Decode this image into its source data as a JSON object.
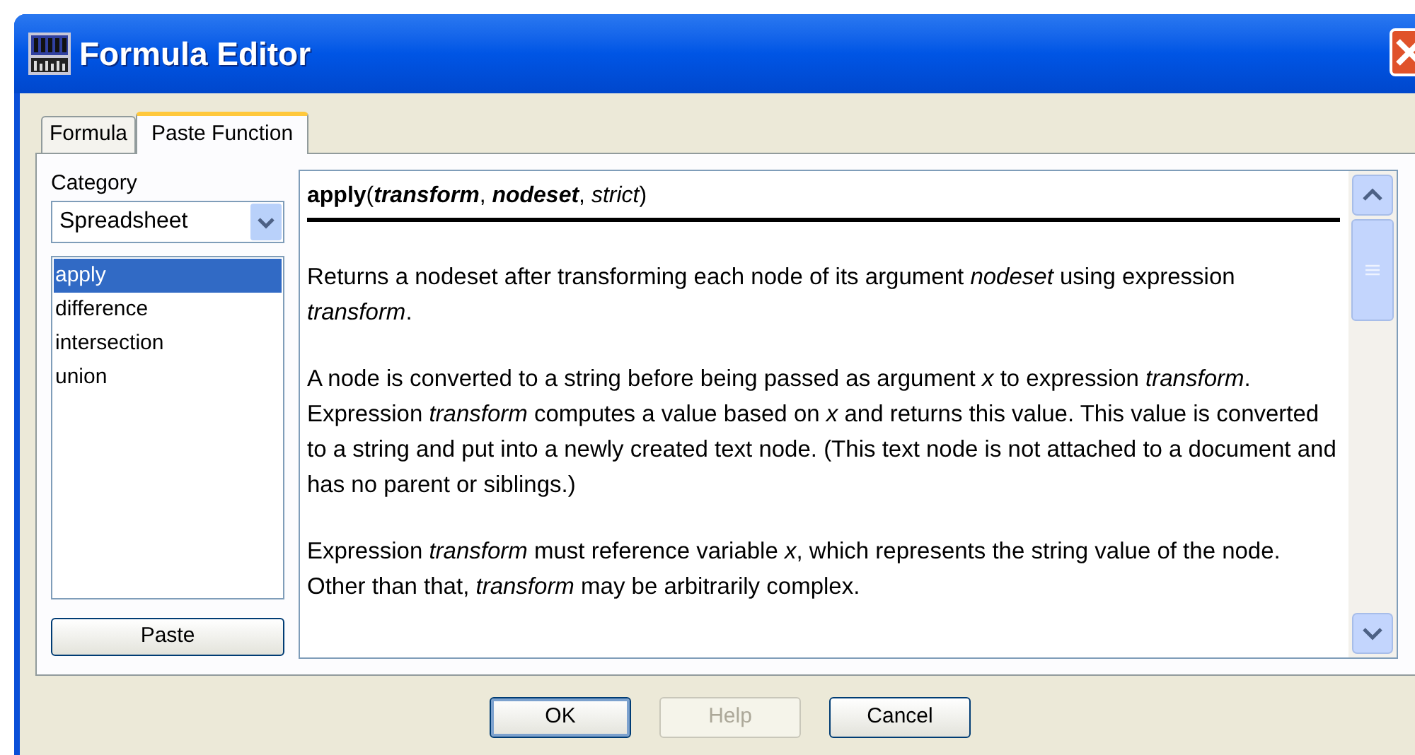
{
  "window": {
    "title": "Formula Editor"
  },
  "tabs": [
    {
      "label": "Formula",
      "selected": false
    },
    {
      "label": "Paste Function",
      "selected": true
    }
  ],
  "category": {
    "label": "Category",
    "value": "Spreadsheet"
  },
  "functions": [
    {
      "label": "apply",
      "selected": true
    },
    {
      "label": "difference",
      "selected": false
    },
    {
      "label": "intersection",
      "selected": false
    },
    {
      "label": "union",
      "selected": false
    }
  ],
  "paste_button": {
    "label": "Paste"
  },
  "doc": {
    "signature": {
      "name": "apply",
      "open": "(",
      "close": ")",
      "separator": ", ",
      "params": [
        {
          "name": "transform",
          "kind": "required"
        },
        {
          "name": "nodeset",
          "kind": "required"
        },
        {
          "name": "strict",
          "kind": "optional"
        }
      ]
    },
    "paragraphs": [
      "Returns a nodeset after transforming each node of its argument *nodeset* using expression *transform*.",
      "A node is converted to a string before being passed as argument *x* to expression *transform*. Expression *transform* computes a value based on *x* and returns this value. This value is converted to a string and put into a newly created text node. (This text node is not attached to a document and has no parent or siblings.)",
      "Expression *transform* must reference variable *x*, which represents the string value of the node. Other than that, *transform* may be arbitrarily complex."
    ]
  },
  "buttons": [
    {
      "label": "OK",
      "disabled": false,
      "default": true
    },
    {
      "label": "Help",
      "disabled": true,
      "default": false
    },
    {
      "label": "Cancel",
      "disabled": false,
      "default": false
    }
  ]
}
